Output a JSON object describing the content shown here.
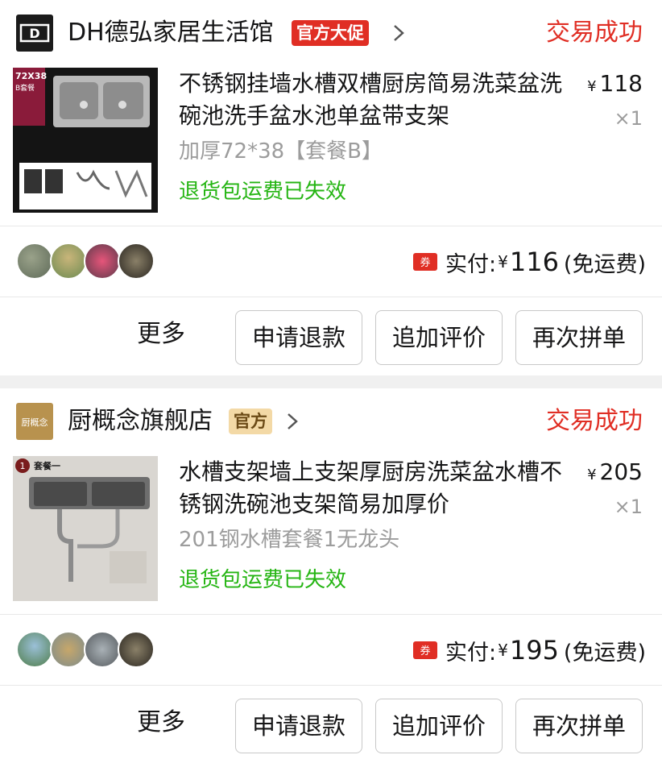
{
  "orders": [
    {
      "shop": {
        "name": "DH德弘家居生活馆",
        "tag": "官方大促",
        "logo_text": "D",
        "tag_color": "#e02e24"
      },
      "status": "交易成功",
      "product": {
        "title": "不锈钢挂墙水槽双槽厨房简易洗菜盆洗碗池洗手盆水池单盆带支架",
        "spec": "加厚72*38【套餐B】",
        "note": "退货包运费已失效",
        "currency": "¥",
        "price": "118",
        "qty": "×1",
        "image_badge": "72X38\nB套餐"
      },
      "payment": {
        "label": "实付:",
        "currency": "¥",
        "amount": "116",
        "shipping": "(免运费)",
        "coupon_icon": "券"
      },
      "actions": {
        "more": "更多",
        "refund": "申请退款",
        "review": "追加评价",
        "reorder": "再次拼单"
      }
    },
    {
      "shop": {
        "name": "厨概念旗舰店",
        "tag": "官方",
        "logo_text": "厨概念",
        "tag_color": "#f3d9a6"
      },
      "status": "交易成功",
      "product": {
        "title": "水槽支架墙上支架厚厨房洗菜盆水槽不锈钢洗碗池支架简易加厚价",
        "spec": "201钢水槽套餐1无龙头",
        "note": "退货包运费已失效",
        "currency": "¥",
        "price": "205",
        "qty": "×1",
        "image_badge": "套餐一"
      },
      "payment": {
        "label": "实付:",
        "currency": "¥",
        "amount": "195",
        "shipping": "(免运费)",
        "coupon_icon": "券"
      },
      "actions": {
        "more": "更多",
        "refund": "申请退款",
        "review": "追加评价",
        "reorder": "再次拼单"
      }
    }
  ],
  "colors": {
    "status_red": "#e02e24",
    "note_green": "#25b513",
    "muted_gray": "#9c9c9c"
  }
}
